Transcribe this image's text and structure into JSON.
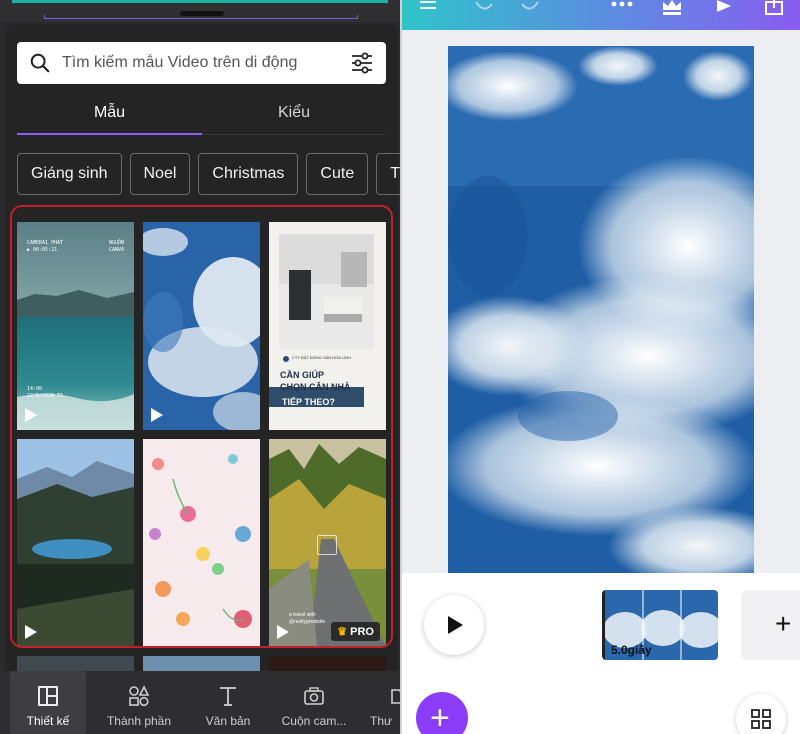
{
  "left_panel": {
    "search": {
      "placeholder": "Tìm kiếm mẫu Video trên di động"
    },
    "tabs": [
      {
        "label": "Mẫu",
        "active": true
      },
      {
        "label": "Kiểu",
        "active": false
      }
    ],
    "chips": [
      "Giáng sinh",
      "Noel",
      "Christmas",
      "Cute",
      "T"
    ],
    "templates": [
      {
        "name": "ocean-template",
        "top_text": "CAMERA1 PHÁT ▶ 00:05:21",
        "top_right": "NGUỒN CANVA",
        "bottom_text": "14:00 22/9/2020 T6"
      },
      {
        "name": "clouds-template"
      },
      {
        "name": "real-estate-template",
        "company": "CTY BẤT ĐỘNG SẢN HOA LINH",
        "headline1": "CẦN GIÚP",
        "headline2": "CHỌN CĂN NHÀ",
        "headline3": "TIẾP THEO?"
      },
      {
        "name": "mountain-lake-template"
      },
      {
        "name": "floral-template"
      },
      {
        "name": "forest-road-template",
        "caption": "a travel with",
        "caption2": "@reallygreatsite",
        "badge": "PRO"
      }
    ],
    "bottom_nav": [
      {
        "label": "Thiết kế",
        "icon": "layout-icon",
        "active": true
      },
      {
        "label": "Thành phần",
        "icon": "shapes-icon"
      },
      {
        "label": "Văn bản",
        "icon": "text-icon"
      },
      {
        "label": "Cuộn cam...",
        "icon": "camera-icon"
      },
      {
        "label": "Thư",
        "icon": "folder-icon"
      }
    ]
  },
  "right_panel": {
    "toolbar_icons": [
      "menu-icon",
      "undo-icon",
      "redo-icon",
      "more-icon",
      "crown-icon",
      "play-icon",
      "share-icon"
    ],
    "timeline": {
      "clip_duration": "5.0giây",
      "add_label": "+"
    },
    "fab_label": "+"
  },
  "colors": {
    "accent": "#8b5cf6",
    "highlight_frame": "#c2202b",
    "fab": "#8b3cf7"
  }
}
